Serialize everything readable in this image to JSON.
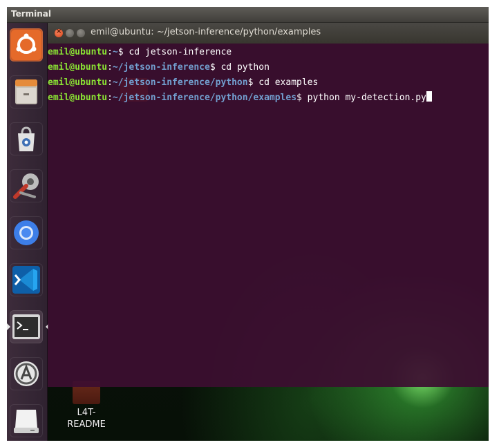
{
  "top_panel": {
    "title": "Terminal"
  },
  "launcher": {
    "items": [
      {
        "name": "ubuntu-dash-icon",
        "color": "#f07c3c"
      },
      {
        "name": "files-icon",
        "color": "#c8c4bc"
      },
      {
        "name": "software-center-icon",
        "color": "#d9d9d9"
      },
      {
        "name": "system-settings-icon",
        "color": "#e8e8e8"
      },
      {
        "name": "chromium-icon",
        "color": "#3d7ee8"
      },
      {
        "name": "vscode-icon",
        "color": "#1a8ad4"
      },
      {
        "name": "terminal-icon",
        "color": "#2e2e2e"
      },
      {
        "name": "software-updater-icon",
        "color": "#ffffff"
      },
      {
        "name": "removable-drive-icon",
        "color": "#e0e0e0"
      }
    ]
  },
  "terminal": {
    "title": "emil@ubuntu: ~/jetson-inference/python/examples",
    "lines": [
      {
        "user": "emil@ubuntu",
        "sep": ":",
        "path": "~",
        "suffix": "$ cd jetson-inference"
      },
      {
        "user": "emil@ubuntu",
        "sep": ":",
        "path": "~/jetson-inference",
        "suffix": "$ cd python"
      },
      {
        "user": "emil@ubuntu",
        "sep": ":",
        "path": "~/jetson-inference/python",
        "suffix": "$ cd examples"
      },
      {
        "user": "emil@ubuntu",
        "sep": ":",
        "path": "~/jetson-inference/python/examples",
        "suffix": "$ python my-detection.py"
      }
    ]
  },
  "desktop": {
    "icon_label": "L4T-\nREADME"
  },
  "colors": {
    "prompt_user": "#8ae234",
    "prompt_path": "#729fcf",
    "terminal_bg": "#3c0e30",
    "close_button": "#e9541f"
  }
}
